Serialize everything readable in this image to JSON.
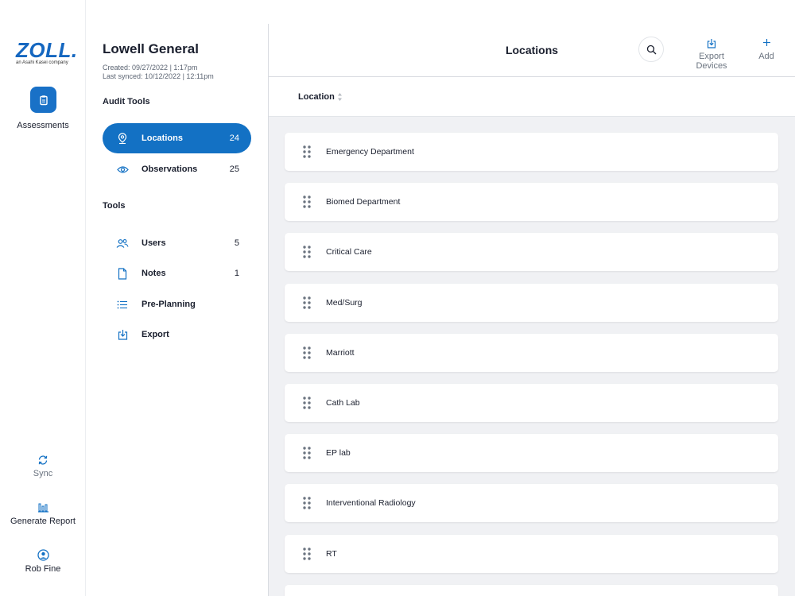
{
  "app": {
    "logo_text": "ZOLL.",
    "logo_sub": "an Asahi Kasei company",
    "rail": {
      "assessments_label": "Assessments",
      "sync_label": "Sync",
      "report_label": "Generate Report",
      "user_label": "Rob Fine"
    }
  },
  "panel": {
    "org_name": "Lowell General",
    "created": "Created: 09/27/2022 | 1:17pm",
    "synced": "Last synced: 10/12/2022 | 12:11pm",
    "audit_title": "Audit Tools",
    "tools_title": "Tools",
    "audit_items": [
      {
        "label": "Locations",
        "count": "24",
        "icon": "map-pin-icon"
      },
      {
        "label": "Observations",
        "count": "25",
        "icon": "eye-icon"
      }
    ],
    "tool_items": [
      {
        "label": "Users",
        "count": "5",
        "icon": "users-icon"
      },
      {
        "label": "Notes",
        "count": "1",
        "icon": "document-icon"
      },
      {
        "label": "Pre-Planning",
        "count": "",
        "icon": "list-icon"
      },
      {
        "label": "Export",
        "count": "",
        "icon": "download-icon"
      }
    ]
  },
  "main": {
    "title": "Locations",
    "export_label": "Export Devices",
    "add_label": "Add",
    "column_header": "Location",
    "locations": [
      "Emergency Department",
      "Biomed Department",
      "Critical Care",
      "Med/Surg",
      "Marriott",
      "Cath Lab",
      "EP lab",
      "Interventional Radiology",
      "RT"
    ]
  },
  "colors": {
    "accent": "#1371c4",
    "background": "#f0f1f4",
    "text": "#1a1f2e"
  }
}
